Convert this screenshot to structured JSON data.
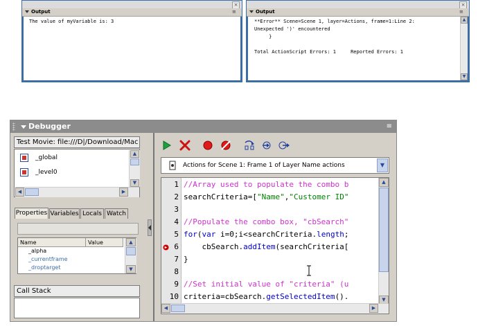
{
  "output_left": {
    "title": "Output",
    "close_glyph": "×",
    "menu_glyph": "≡",
    "line1": "The value of myVariable is: 3"
  },
  "output_right": {
    "title": "Output",
    "close_glyph": "×",
    "menu_glyph": "≡",
    "line1": "**Error** Scene=Scene 1, layer=Actions, frame=1:Line 2:",
    "line2": "Unexpected ')' encountered",
    "line3": "     }",
    "line4": "Total ActionScript Errors: 1     Reported Errors: 1"
  },
  "debugger": {
    "title": "Debugger",
    "menu_glyph": "≡",
    "test_movie_label": "Test Movie: file:///D|/Download/Mac",
    "movie_items": [
      {
        "label": "_global"
      },
      {
        "label": "_level0"
      }
    ],
    "tabs": [
      "Properties",
      "Variables",
      "Locals",
      "Watch"
    ],
    "grid_headers": {
      "name": "Name",
      "value": "Value"
    },
    "grid_rows": [
      {
        "name": "_alpha",
        "value": ""
      },
      {
        "name": "_currentframe",
        "value": ""
      },
      {
        "name": "_droptarget",
        "value": ""
      }
    ],
    "call_stack_label": "Call Stack",
    "script_selector": "Actions for Scene 1: Frame 1  of Layer Name actions",
    "code_lines": [
      {
        "n": "1",
        "parts": [
          {
            "t": "//Array used to populate the combo b",
            "c": "cm"
          }
        ]
      },
      {
        "n": "2",
        "parts": [
          {
            "t": "searchCriteria=[",
            "c": "sym"
          },
          {
            "t": "\"Name\"",
            "c": "st"
          },
          {
            "t": ",",
            "c": "sym"
          },
          {
            "t": "\"Customer ID\"",
            "c": "st"
          }
        ]
      },
      {
        "n": "3",
        "parts": []
      },
      {
        "n": "4",
        "parts": [
          {
            "t": "//Populate the combo box, \"cbSearch\"",
            "c": "cm"
          }
        ]
      },
      {
        "n": "5",
        "parts": [
          {
            "t": "for",
            "c": "kw"
          },
          {
            "t": "(",
            "c": "sym"
          },
          {
            "t": "var",
            "c": "kw"
          },
          {
            "t": " i=0;i<searchCriteria.",
            "c": "sym"
          },
          {
            "t": "length",
            "c": "mb"
          },
          {
            "t": ";",
            "c": "sym"
          }
        ]
      },
      {
        "n": "6",
        "parts": [
          {
            "t": "    cbSearch.",
            "c": "sym"
          },
          {
            "t": "addItem",
            "c": "mb"
          },
          {
            "t": "(searchCriteria[",
            "c": "sym"
          }
        ]
      },
      {
        "n": "7",
        "parts": [
          {
            "t": "}",
            "c": "sym"
          }
        ]
      },
      {
        "n": "8",
        "parts": []
      },
      {
        "n": "9",
        "parts": [
          {
            "t": "//Set initial value of \"criteria\" (u",
            "c": "cm"
          }
        ]
      },
      {
        "n": "10",
        "parts": [
          {
            "t": "criteria=cbSearch.",
            "c": "sym"
          },
          {
            "t": "getSelectedItem",
            "c": "mb"
          },
          {
            "t": "().",
            "c": "sym"
          }
        ]
      }
    ],
    "breakpoint_line": "6"
  },
  "colors": {
    "comment": "#cc33cc",
    "keyword": "#0000cc",
    "string": "#008000",
    "breakpoint": "#cc0000",
    "output_border": "#3a6ea5",
    "debugger_title": "#8c8c8c"
  }
}
